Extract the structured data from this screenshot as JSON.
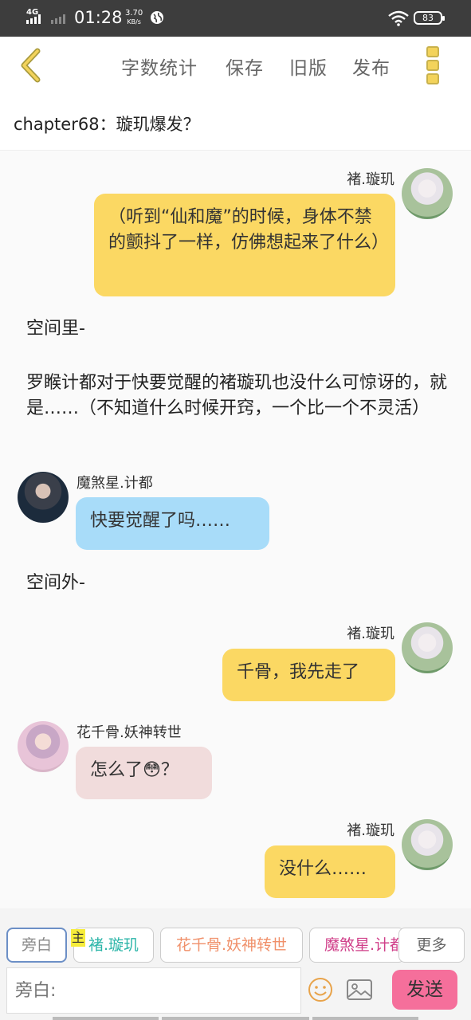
{
  "status_bar": {
    "network": "4G",
    "time": "01:28",
    "speed_value": "3.70",
    "speed_unit": "KB/s",
    "battery": "83"
  },
  "toolbar": {
    "word_count": "字数统计",
    "save": "保存",
    "old_version": "旧版",
    "publish": "发布"
  },
  "chapter_title": "chapter68：璇玑爆发？",
  "messages": [
    {
      "speaker": "褚.璇玑",
      "text": "（听到“仙和魔”的时候，身体不禁的颤抖了一样，仿佛想起来了什么）"
    },
    {
      "narration": "空间里-"
    },
    {
      "narration": "罗睺计都对于快要觉醒的褚璇玑也没什么可惊讶的，就是……（不知道什么时候开窍，一个比一个不灵活）"
    },
    {
      "speaker": "魔煞星.计都",
      "text": "快要觉醒了吗……"
    },
    {
      "narration": "空间外-"
    },
    {
      "speaker": "褚.璇玑",
      "text": "千骨，我先走了"
    },
    {
      "speaker": "花千骨.妖神转世",
      "text": "怎么了😳？"
    },
    {
      "speaker": "褚.璇玑",
      "text": "没什么……"
    }
  ],
  "composer": {
    "roles": [
      "旁白",
      "褚.璇玑",
      "花千骨.妖神转世",
      "魔煞星.计都"
    ],
    "role_colors": [
      "#888888",
      "#2bb5a8",
      "#f0906a",
      "#d0408a"
    ],
    "main_badge": "主",
    "more": "更多",
    "input_placeholder": "旁白:",
    "send": "发送"
  }
}
